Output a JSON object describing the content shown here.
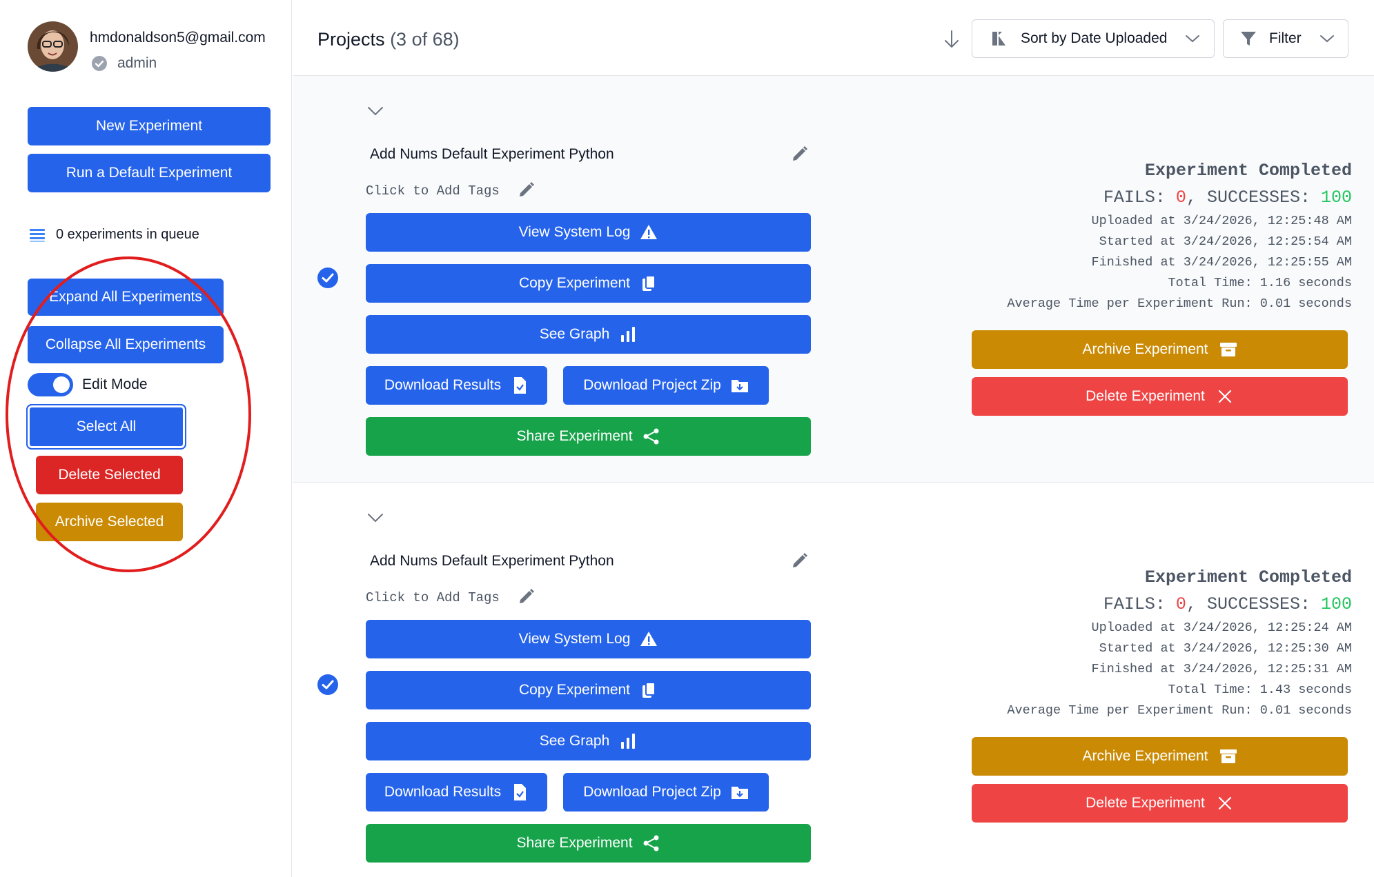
{
  "sidebar": {
    "user": {
      "email": "hmdonaldson5@gmail.com",
      "role": "admin"
    },
    "new_experiment": "New Experiment",
    "run_default": "Run a Default Experiment",
    "queue_text": "0 experiments in queue",
    "expand_all": "Expand All Experiments",
    "collapse_all": "Collapse All Experiments",
    "edit_mode": {
      "label": "Edit Mode",
      "on": true
    },
    "select_all": "Select All",
    "delete_selected": "Delete Selected",
    "archive_selected": "Archive Selected"
  },
  "header": {
    "title": "Projects",
    "count": "(3 of 68)",
    "sort_label": "Sort by Date Uploaded",
    "filter_label": "Filter"
  },
  "colors": {
    "primary": "#2563eb",
    "success_btn": "#16a34a",
    "archive": "#ca8a04",
    "delete": "#ef4444",
    "delete_selected": "#dc2626",
    "annotation": "#e11d1d"
  },
  "experiments": [
    {
      "title": "Add Nums Default Experiment Python",
      "tags_placeholder": "Click to Add Tags",
      "selected": true,
      "buttons": {
        "view_log": "View System Log",
        "copy": "Copy Experiment",
        "graph": "See Graph",
        "download_results": "Download Results",
        "download_zip": "Download Project Zip",
        "share": "Share Experiment",
        "archive": "Archive Experiment",
        "delete": "Delete Experiment"
      },
      "status": {
        "title": "Experiment Completed",
        "fails_label": "FAILS: ",
        "fails": "0",
        "sep": ", SUCCESSES: ",
        "successes": "100",
        "uploaded": "Uploaded at 3/24/2026, 12:25:48 AM",
        "started": "Started at 3/24/2026, 12:25:54 AM",
        "finished": "Finished at 3/24/2026, 12:25:55 AM",
        "total": "Total Time: 1.16 seconds",
        "average": "Average Time per Experiment Run: 0.01 seconds"
      }
    },
    {
      "title": "Add Nums Default Experiment Python",
      "tags_placeholder": "Click to Add Tags",
      "selected": true,
      "buttons": {
        "view_log": "View System Log",
        "copy": "Copy Experiment",
        "graph": "See Graph",
        "download_results": "Download Results",
        "download_zip": "Download Project Zip",
        "share": "Share Experiment",
        "archive": "Archive Experiment",
        "delete": "Delete Experiment"
      },
      "status": {
        "title": "Experiment Completed",
        "fails_label": "FAILS: ",
        "fails": "0",
        "sep": ", SUCCESSES: ",
        "successes": "100",
        "uploaded": "Uploaded at 3/24/2026, 12:25:24 AM",
        "started": "Started at 3/24/2026, 12:25:30 AM",
        "finished": "Finished at 3/24/2026, 12:25:31 AM",
        "total": "Total Time: 1.43 seconds",
        "average": "Average Time per Experiment Run: 0.01 seconds"
      }
    }
  ]
}
